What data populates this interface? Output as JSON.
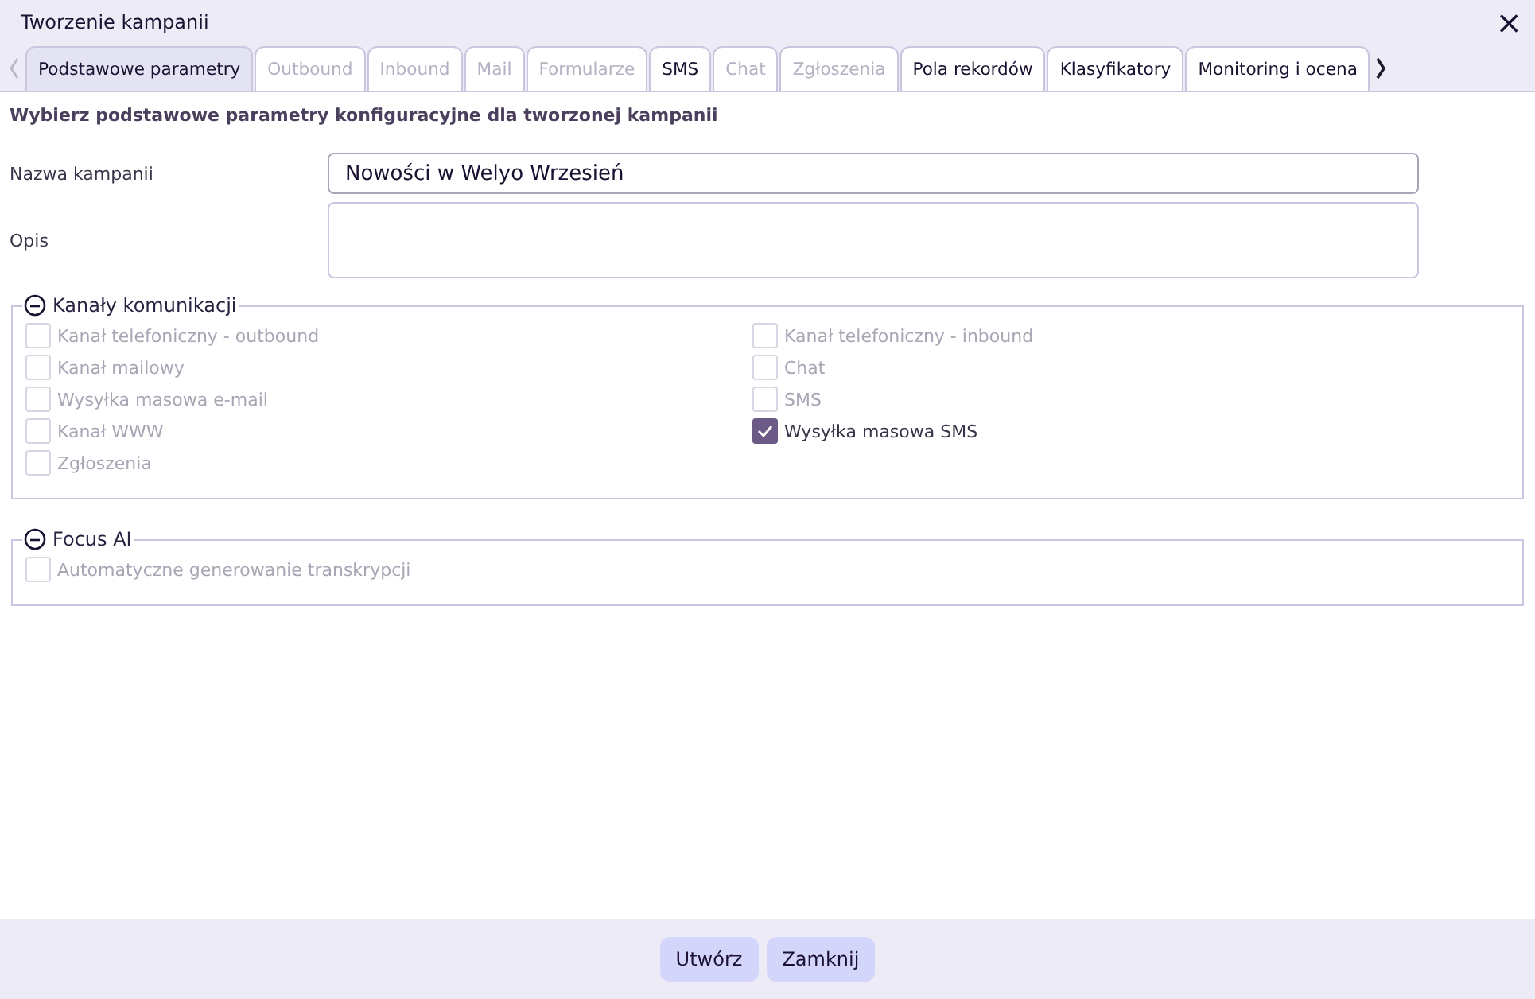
{
  "window": {
    "title": "Tworzenie kampanii",
    "close": "×"
  },
  "tabs": [
    {
      "label": "Podstawowe parametry",
      "selected": true,
      "disabled": false
    },
    {
      "label": "Outbound",
      "selected": false,
      "disabled": true
    },
    {
      "label": "Inbound",
      "selected": false,
      "disabled": true
    },
    {
      "label": "Mail",
      "selected": false,
      "disabled": true
    },
    {
      "label": "Formularze",
      "selected": false,
      "disabled": true
    },
    {
      "label": "SMS",
      "selected": false,
      "disabled": false
    },
    {
      "label": "Chat",
      "selected": false,
      "disabled": true
    },
    {
      "label": "Zgłoszenia",
      "selected": false,
      "disabled": true
    },
    {
      "label": "Pola rekordów",
      "selected": false,
      "disabled": false
    },
    {
      "label": "Klasyfikatory",
      "selected": false,
      "disabled": false
    },
    {
      "label": "Monitoring i ocena",
      "selected": false,
      "disabled": false
    }
  ],
  "heading": "Wybierz podstawowe parametry konfiguracyjne dla tworzonej kampanii",
  "fields": [
    {
      "label": "Nazwa kampanii",
      "kind": "input",
      "value": "Nowości w Welyo Wrzesień"
    },
    {
      "label": "Opis",
      "kind": "textarea"
    }
  ],
  "groups": [
    {
      "title": "Kanały komunikacji",
      "expanded": true,
      "columns": [
        [
          {
            "label": "Kanał telefoniczny - outbound",
            "checked": false,
            "disabled": true
          },
          {
            "label": "Kanał mailowy",
            "checked": false,
            "disabled": true
          },
          {
            "label": "Wysyłka masowa e-mail",
            "checked": false,
            "disabled": true
          },
          {
            "label": "Kanał WWW",
            "checked": false,
            "disabled": true
          },
          {
            "label": "Zgłoszenia",
            "checked": false,
            "disabled": true
          }
        ],
        [
          {
            "label": "Kanał telefoniczny - inbound",
            "checked": false,
            "disabled": true
          },
          {
            "label": "Chat",
            "checked": false,
            "disabled": true
          },
          {
            "label": "SMS",
            "checked": false,
            "disabled": true
          },
          {
            "label": "Wysyłka masowa SMS",
            "checked": true,
            "disabled": false
          }
        ]
      ]
    },
    {
      "title": "Focus AI",
      "expanded": true,
      "columns": [
        [
          {
            "label": "Automatyczne generowanie transkrypcji",
            "checked": false,
            "disabled": true
          }
        ]
      ]
    }
  ],
  "buttons": [
    "Utwórz",
    "Zamknij"
  ]
}
